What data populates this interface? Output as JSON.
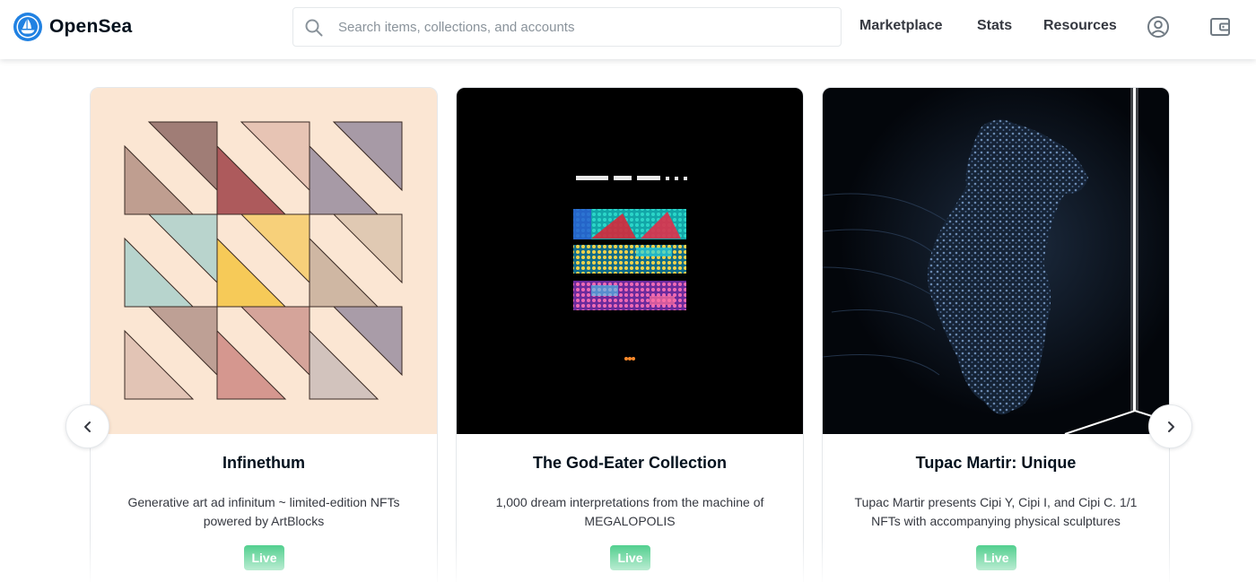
{
  "header": {
    "brand": "OpenSea",
    "search_placeholder": "Search items, collections, and accounts",
    "nav": {
      "marketplace": "Marketplace",
      "stats": "Stats",
      "resources": "Resources"
    },
    "icons": [
      "opensea-logo-icon",
      "search-icon",
      "account-icon",
      "wallet-icon"
    ]
  },
  "colors": {
    "brand_blue": "#2081e2",
    "live_green": "#34c77b",
    "card1_background": "#fbe6d3"
  },
  "carousel": {
    "prev_icon": "chevron-left-icon",
    "next_icon": "chevron-right-icon",
    "cards": [
      {
        "title": "Infinethum",
        "description": "Generative art ad infinitum ~ limited-edition NFTs powered by ArtBlocks",
        "status": "Live"
      },
      {
        "title": "The God-Eater Collection",
        "description": "1,000 dream interpretations from the machine of MEGALOPOLIS",
        "status": "Live"
      },
      {
        "title": "Tupac Martir: Unique",
        "description": "Tupac Martir presents Cipi Y, Cipi I, and Cipi C. 1/1 NFTs with accompanying physical sculptures",
        "status": "Live"
      }
    ]
  }
}
